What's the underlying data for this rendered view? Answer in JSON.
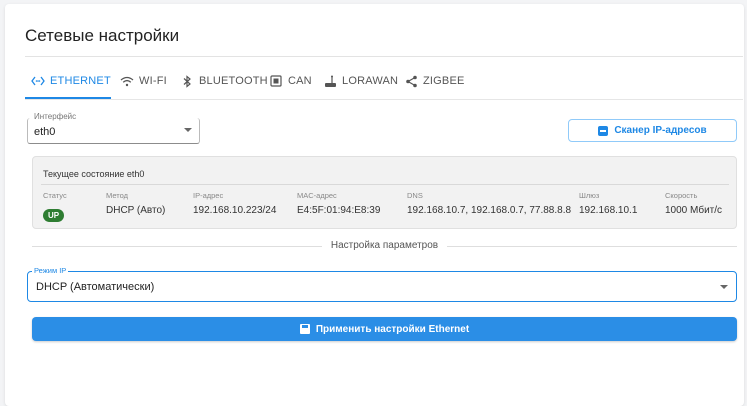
{
  "page": {
    "title": "Сетевые настройки"
  },
  "tabs": [
    {
      "label": "ETHERNET",
      "icon": "ethernet-icon"
    },
    {
      "label": "WI-FI",
      "icon": "wifi-icon"
    },
    {
      "label": "BLUETOOTH",
      "icon": "bluetooth-icon"
    },
    {
      "label": "CAN",
      "icon": "can-icon"
    },
    {
      "label": "LORAWAN",
      "icon": "antenna-icon"
    },
    {
      "label": "ZIGBEE",
      "icon": "share-icon"
    }
  ],
  "interface": {
    "legend": "Интерфейс",
    "value": "eth0"
  },
  "scanner": {
    "label": "Сканер IP-адресов",
    "icon": "scanner-icon"
  },
  "status": {
    "title": "Текущее состояние eth0",
    "columns": [
      {
        "label": "Статус",
        "value": "UP"
      },
      {
        "label": "Метод",
        "value": "DHCP (Авто)"
      },
      {
        "label": "IP-адрес",
        "value": "192.168.10.223/24"
      },
      {
        "label": "MAC-адрес",
        "value": "E4:5F:01:94:E8:39"
      },
      {
        "label": "DNS",
        "value": "192.168.10.7, 192.168.0.7, 77.88.8.8"
      },
      {
        "label": "Шлюз",
        "value": "192.168.10.1"
      },
      {
        "label": "Скорость",
        "value": "1000 Мбит/с"
      }
    ],
    "badge_color": "#2e7d32"
  },
  "section": {
    "label": "Настройка параметров"
  },
  "ip_mode": {
    "legend": "Режим IP",
    "value": "DHCP (Автоматически)"
  },
  "apply": {
    "label": "Применить настройки Ethernet",
    "icon": "save-icon"
  },
  "colors": {
    "accent": "#1e88e5",
    "button": "#2b8ee6"
  }
}
